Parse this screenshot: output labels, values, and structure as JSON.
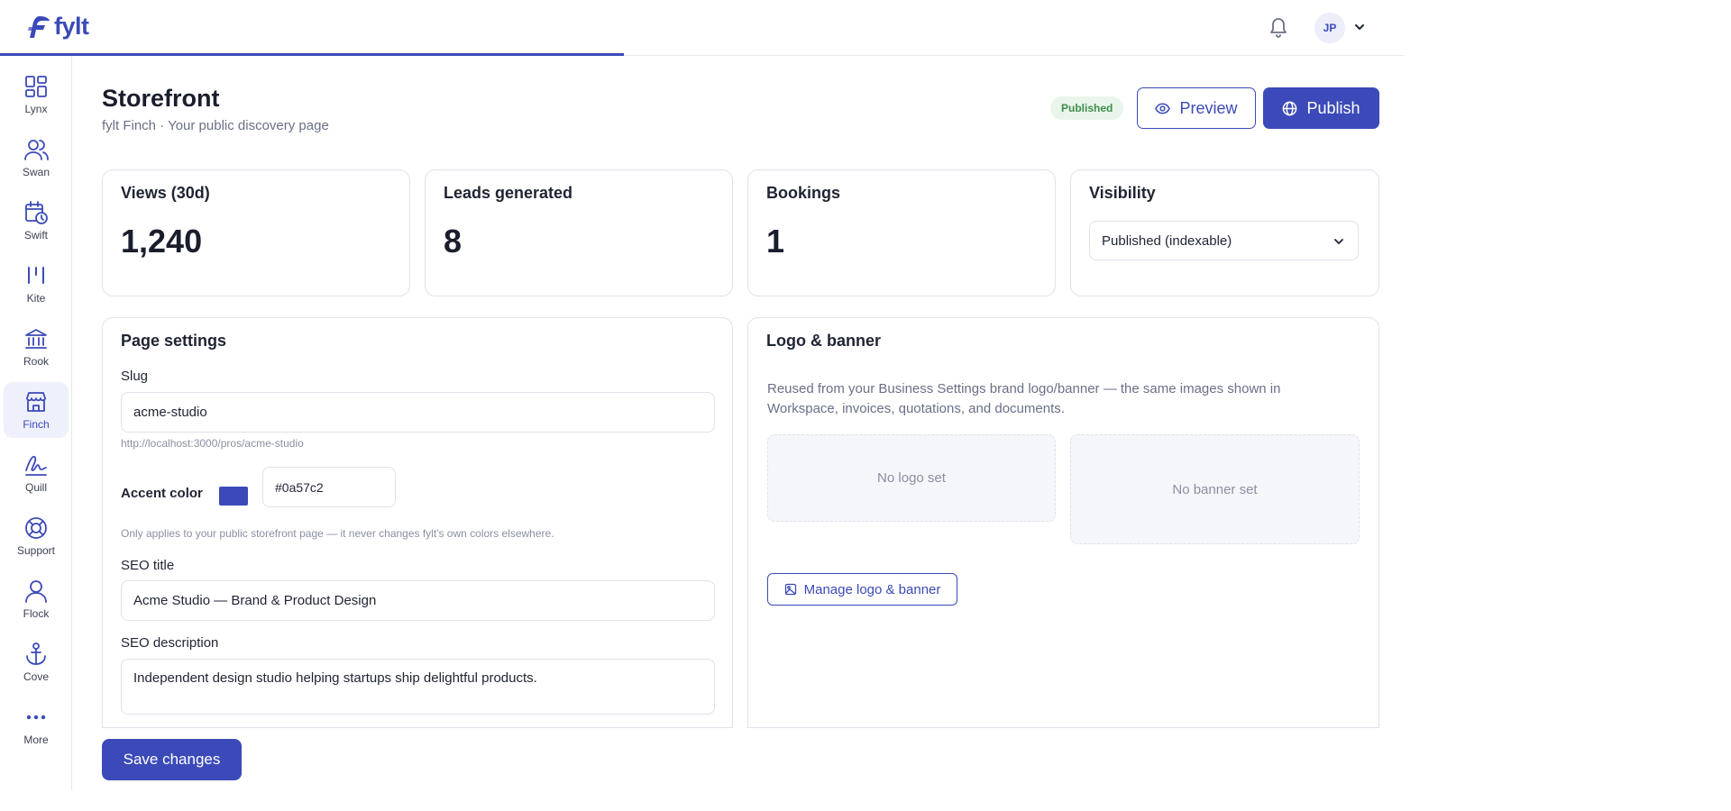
{
  "brand": {
    "name": "fylt"
  },
  "user": {
    "initials": "JP"
  },
  "nav": [
    {
      "label": "Lynx",
      "icon": "grid-icon"
    },
    {
      "label": "Swan",
      "icon": "users-icon"
    },
    {
      "label": "Swift",
      "icon": "calendar-clock-icon"
    },
    {
      "label": "Kite",
      "icon": "kite-icon"
    },
    {
      "label": "Rook",
      "icon": "bank-icon"
    },
    {
      "label": "Finch",
      "icon": "store-icon",
      "active": true
    },
    {
      "label": "Quill",
      "icon": "signature-icon"
    },
    {
      "label": "Support",
      "icon": "lifebuoy-icon"
    },
    {
      "label": "Flock",
      "icon": "user-group-icon"
    },
    {
      "label": "Cove",
      "icon": "anchor-icon"
    },
    {
      "label": "More",
      "icon": "more-dots-icon"
    }
  ],
  "page": {
    "title": "Storefront",
    "subtitle": "fylt Finch · Your public discovery page",
    "status_badge": "Published",
    "preview_label": "Preview",
    "publish_label": "Publish"
  },
  "stats": {
    "views": {
      "title": "Views (30d)",
      "value": "1,240"
    },
    "leads": {
      "title": "Leads generated",
      "value": "8"
    },
    "bookings": {
      "title": "Bookings",
      "value": "1"
    },
    "visibility": {
      "title": "Visibility",
      "selected": "Published (indexable)"
    }
  },
  "settings": {
    "title": "Page settings",
    "slug_label": "Slug",
    "slug_value": "acme-studio",
    "slug_url": "http://localhost:3000/pros/acme-studio",
    "accent_label": "Accent color",
    "accent_value": "#0a57c2",
    "accent_hint": "Only applies to your public storefront page — it never changes fylt's own colors elsewhere.",
    "seo_title_label": "SEO title",
    "seo_title_value": "Acme Studio — Brand & Product Design",
    "seo_desc_label": "SEO description",
    "seo_desc_value": "Independent design studio helping startups ship delightful products."
  },
  "logo_banner": {
    "title": "Logo & banner",
    "description": "Reused from your Business Settings brand logo/banner — the same images shown in Workspace, invoices, quotations, and documents.",
    "no_logo": "No logo set",
    "no_banner": "No banner set",
    "manage_label": "Manage logo & banner"
  },
  "save_label": "Save changes",
  "colors": {
    "accent": "#3b4ab8",
    "badge_bg": "#e9f5ea",
    "badge_text": "#3f8f4a"
  }
}
